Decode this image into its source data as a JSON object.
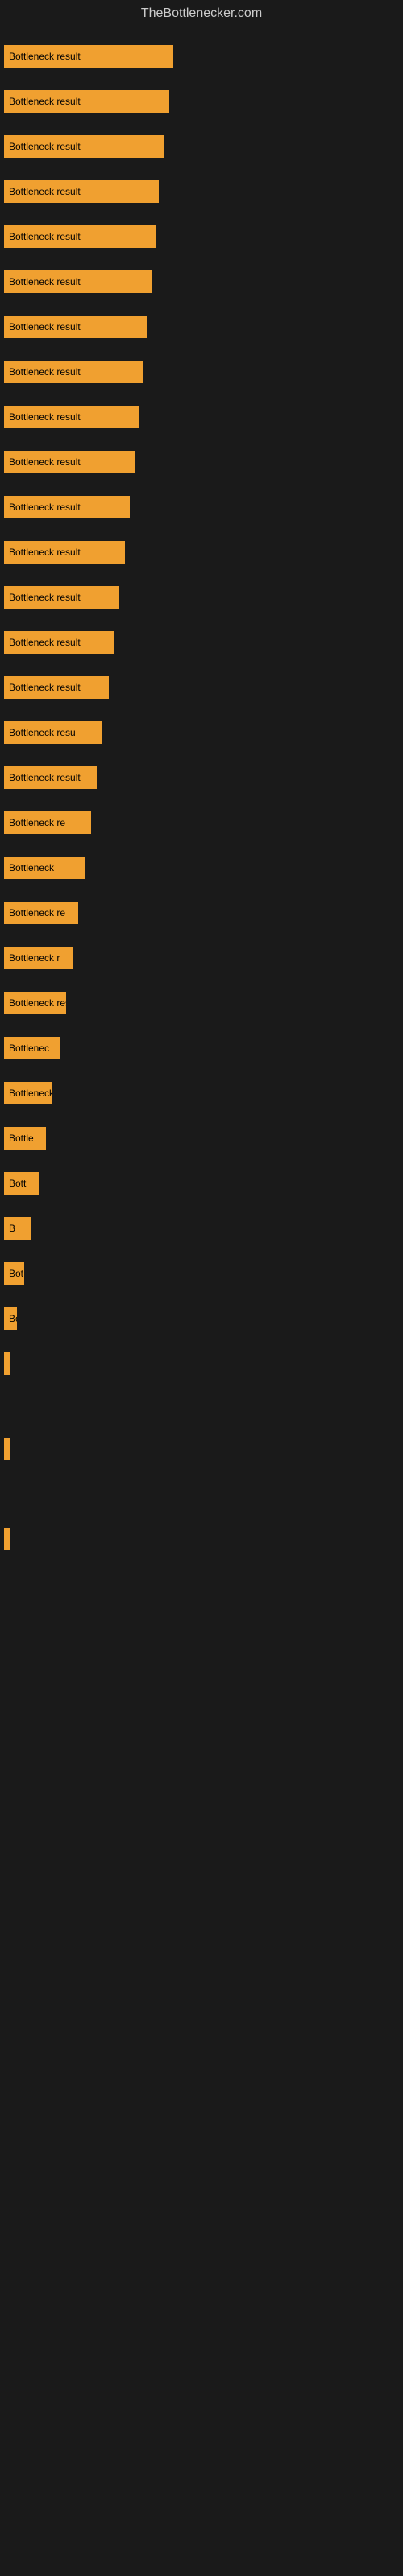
{
  "site": {
    "title": "TheBottlenecker.com"
  },
  "bars": [
    {
      "id": 1,
      "label": "Bottleneck result",
      "width_class": "bar-1"
    },
    {
      "id": 2,
      "label": "Bottleneck result",
      "width_class": "bar-2"
    },
    {
      "id": 3,
      "label": "Bottleneck result",
      "width_class": "bar-3"
    },
    {
      "id": 4,
      "label": "Bottleneck result",
      "width_class": "bar-4"
    },
    {
      "id": 5,
      "label": "Bottleneck result",
      "width_class": "bar-5"
    },
    {
      "id": 6,
      "label": "Bottleneck result",
      "width_class": "bar-6"
    },
    {
      "id": 7,
      "label": "Bottleneck result",
      "width_class": "bar-7"
    },
    {
      "id": 8,
      "label": "Bottleneck result",
      "width_class": "bar-8"
    },
    {
      "id": 9,
      "label": "Bottleneck result",
      "width_class": "bar-9"
    },
    {
      "id": 10,
      "label": "Bottleneck result",
      "width_class": "bar-10"
    },
    {
      "id": 11,
      "label": "Bottleneck result",
      "width_class": "bar-11"
    },
    {
      "id": 12,
      "label": "Bottleneck result",
      "width_class": "bar-12"
    },
    {
      "id": 13,
      "label": "Bottleneck result",
      "width_class": "bar-13"
    },
    {
      "id": 14,
      "label": "Bottleneck result",
      "width_class": "bar-14"
    },
    {
      "id": 15,
      "label": "Bottleneck result",
      "width_class": "bar-15"
    },
    {
      "id": 16,
      "label": "Bottleneck resu",
      "width_class": "bar-16"
    },
    {
      "id": 17,
      "label": "Bottleneck result",
      "width_class": "bar-17"
    },
    {
      "id": 18,
      "label": "Bottleneck re",
      "width_class": "bar-18"
    },
    {
      "id": 19,
      "label": "Bottleneck",
      "width_class": "bar-19"
    },
    {
      "id": 20,
      "label": "Bottleneck re",
      "width_class": "bar-20"
    },
    {
      "id": 21,
      "label": "Bottleneck r",
      "width_class": "bar-21"
    },
    {
      "id": 22,
      "label": "Bottleneck resu",
      "width_class": "bar-22"
    },
    {
      "id": 23,
      "label": "Bottlenec",
      "width_class": "bar-23"
    },
    {
      "id": 24,
      "label": "Bottleneck re",
      "width_class": "bar-24"
    },
    {
      "id": 25,
      "label": "Bottle",
      "width_class": "bar-25"
    },
    {
      "id": 26,
      "label": "Bott",
      "width_class": "bar-26"
    },
    {
      "id": 27,
      "label": "B",
      "width_class": "bar-27"
    },
    {
      "id": 28,
      "label": "Bot",
      "width_class": "bar-28"
    },
    {
      "id": 29,
      "label": "Bottler",
      "width_class": "bar-29"
    },
    {
      "id": 30,
      "label": "B",
      "width_class": "bar-30"
    }
  ],
  "colors": {
    "bar_fill": "#f0a030",
    "background": "#1a1a1a",
    "title_text": "#cccccc"
  }
}
